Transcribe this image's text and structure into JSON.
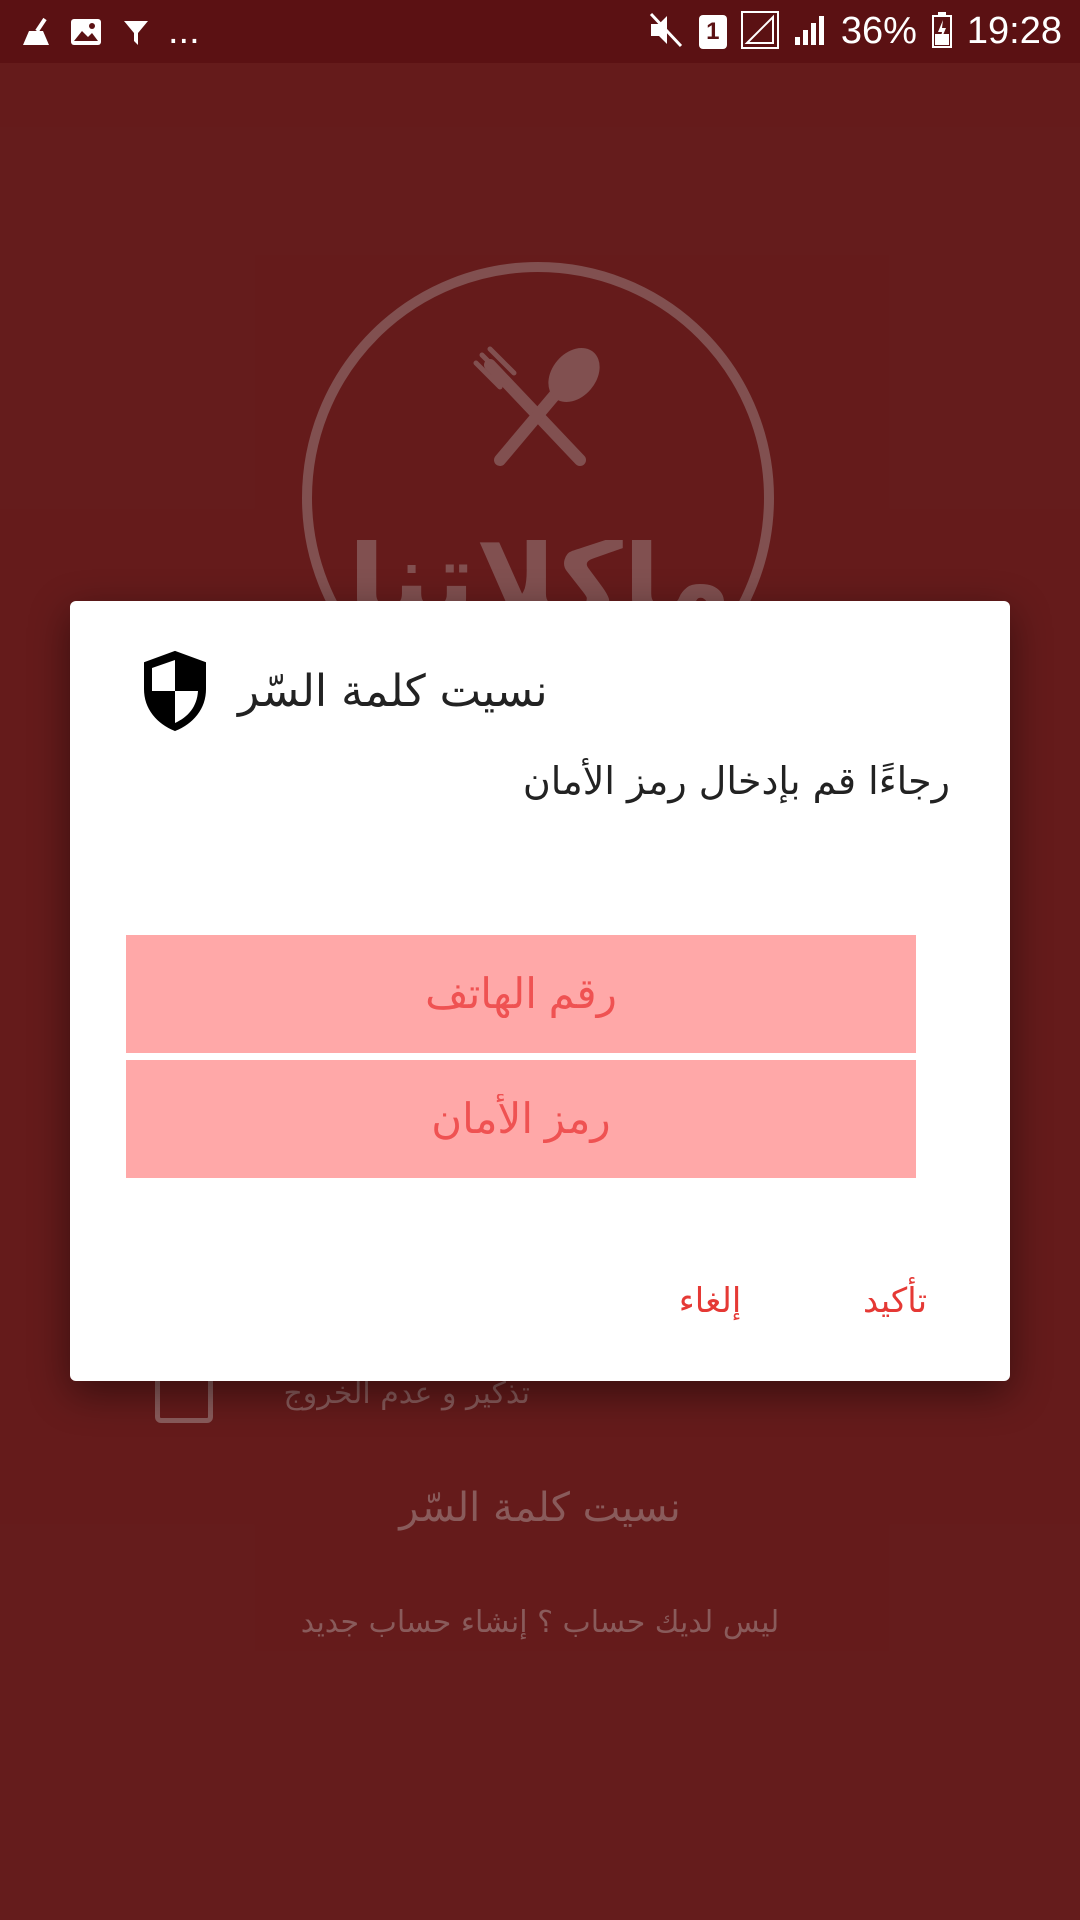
{
  "status_bar": {
    "battery": "36%",
    "time": "19:28",
    "sim_slot": "1",
    "overflow": "...",
    "icons_left": [
      "cleaner-icon",
      "image-icon",
      "filter-icon"
    ],
    "icons_right": [
      "mute-icon",
      "sim-icon",
      "signal-icon",
      "signal-icon-2",
      "battery-icon"
    ]
  },
  "background": {
    "logo_text": "ماكلاتنا",
    "remember_label": "تذكير و عدم الخروج",
    "forgot_password": "نسيت كلمة السّر",
    "signup_prompt": "ليس لديك حساب ؟ إنشاء حساب جديد"
  },
  "dialog": {
    "title": "نسيت كلمة السّر",
    "message": "رجاءًا قم بإدخال رمز الأمان",
    "phone_placeholder": "رقم الهاتف",
    "code_placeholder": "رمز الأمان",
    "cancel_label": "إلغاء",
    "confirm_label": "تأكيد",
    "icon": "shield-icon"
  },
  "colors": {
    "primary_dark": "#5b1113",
    "primary": "#9a2a2a",
    "field_bg": "#ffa8a8",
    "accent": "#e53935"
  }
}
